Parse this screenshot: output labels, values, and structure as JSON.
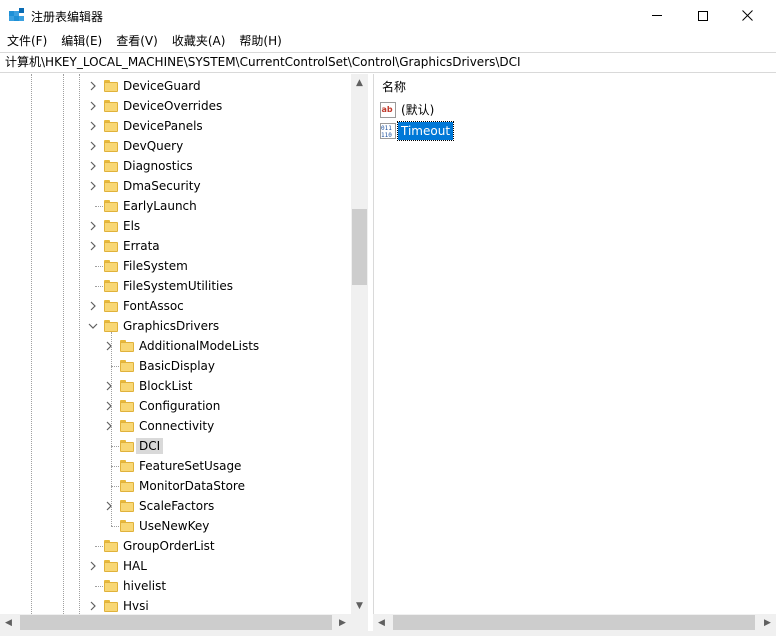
{
  "window": {
    "title": "注册表编辑器",
    "minimize_label": "—",
    "close_label": "✕"
  },
  "menu": [
    "文件(F)",
    "编辑(E)",
    "查看(V)",
    "收藏夹(A)",
    "帮助(H)"
  ],
  "address": "计算机\\HKEY_LOCAL_MACHINE\\SYSTEM\\CurrentControlSet\\Control\\GraphicsDrivers\\DCI",
  "tree": {
    "items": [
      {
        "label": "DeviceGuard",
        "level": 1,
        "expander": "collapsed"
      },
      {
        "label": "DeviceOverrides",
        "level": 1,
        "expander": "collapsed"
      },
      {
        "label": "DevicePanels",
        "level": 1,
        "expander": "collapsed"
      },
      {
        "label": "DevQuery",
        "level": 1,
        "expander": "collapsed"
      },
      {
        "label": "Diagnostics",
        "level": 1,
        "expander": "collapsed"
      },
      {
        "label": "DmaSecurity",
        "level": 1,
        "expander": "collapsed"
      },
      {
        "label": "EarlyLaunch",
        "level": 1,
        "expander": "none"
      },
      {
        "label": "Els",
        "level": 1,
        "expander": "collapsed"
      },
      {
        "label": "Errata",
        "level": 1,
        "expander": "collapsed"
      },
      {
        "label": "FileSystem",
        "level": 1,
        "expander": "none"
      },
      {
        "label": "FileSystemUtilities",
        "level": 1,
        "expander": "none"
      },
      {
        "label": "FontAssoc",
        "level": 1,
        "expander": "collapsed"
      },
      {
        "label": "GraphicsDrivers",
        "level": 1,
        "expander": "expanded"
      },
      {
        "label": "AdditionalModeLists",
        "level": 2,
        "expander": "collapsed"
      },
      {
        "label": "BasicDisplay",
        "level": 2,
        "expander": "none"
      },
      {
        "label": "BlockList",
        "level": 2,
        "expander": "collapsed"
      },
      {
        "label": "Configuration",
        "level": 2,
        "expander": "collapsed"
      },
      {
        "label": "Connectivity",
        "level": 2,
        "expander": "collapsed"
      },
      {
        "label": "DCI",
        "level": 2,
        "expander": "none",
        "selected": true
      },
      {
        "label": "FeatureSetUsage",
        "level": 2,
        "expander": "none"
      },
      {
        "label": "MonitorDataStore",
        "level": 2,
        "expander": "none"
      },
      {
        "label": "ScaleFactors",
        "level": 2,
        "expander": "collapsed"
      },
      {
        "label": "UseNewKey",
        "level": 2,
        "expander": "none"
      },
      {
        "label": "GroupOrderList",
        "level": 1,
        "expander": "none"
      },
      {
        "label": "HAL",
        "level": 1,
        "expander": "collapsed"
      },
      {
        "label": "hivelist",
        "level": 1,
        "expander": "none"
      },
      {
        "label": "Hvsi",
        "level": 1,
        "expander": "collapsed"
      }
    ]
  },
  "values": {
    "header_name": "名称",
    "rows": [
      {
        "name": "(默认)",
        "type": "string",
        "icon": "string-value-icon"
      },
      {
        "name": "Timeout",
        "type": "dword",
        "icon": "binary-value-icon",
        "selected": true
      }
    ]
  },
  "colors": {
    "selection_blue": "#0078d7",
    "folder_yellow": "#f8d775",
    "tree_selection_gray": "#d9d9d9"
  }
}
